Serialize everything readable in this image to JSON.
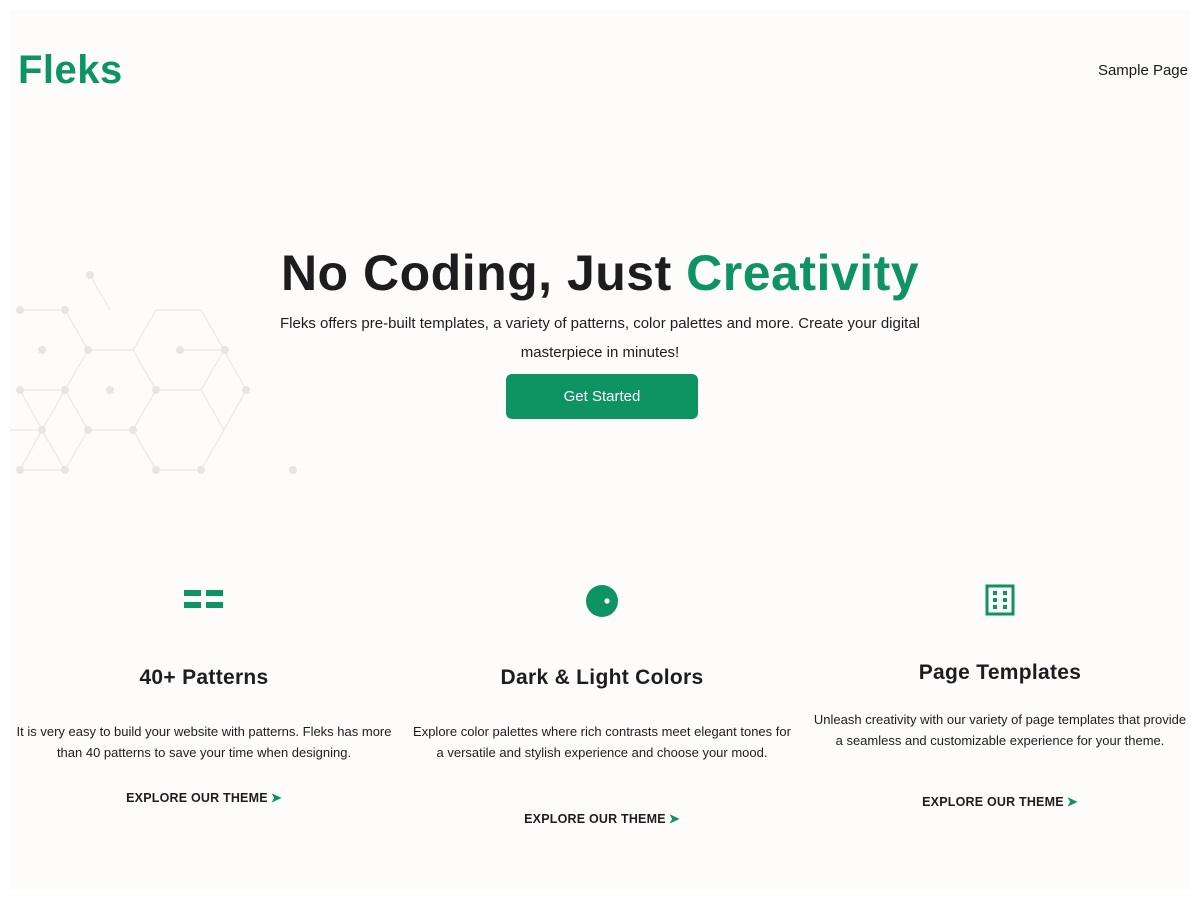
{
  "header": {
    "logo": "Fleks",
    "nav": [
      "Sample Page"
    ]
  },
  "hero": {
    "title_main": "No Coding, Just ",
    "title_accent": "Creativity",
    "subtitle": "Fleks offers pre-built templates, a variety of patterns, color palettes and more. Create your digital masterpiece in minutes!",
    "cta_label": "Get Started"
  },
  "features": [
    {
      "icon": "patterns-icon",
      "title": "40+ Patterns",
      "text": "It is very easy to build your website with patterns. Fleks has more than 40 patterns to save your time when designing.",
      "link": "EXPLORE OUR THEME"
    },
    {
      "icon": "color-circle-icon",
      "title": "Dark & Light Colors",
      "text": "Explore color palettes where rich contrasts meet elegant tones for a versatile and stylish experience and choose your mood.",
      "link": "EXPLORE OUR THEME"
    },
    {
      "icon": "page-templates-icon",
      "title": "Page Templates",
      "text": "Unleash creativity with our variety of page templates that provide a seamless and customizable experience for your theme.",
      "link": "EXPLORE OUR THEME"
    }
  ],
  "colors": {
    "accent": "#0d9462",
    "text": "#1d1d1f",
    "background": "#fdfcfb"
  }
}
